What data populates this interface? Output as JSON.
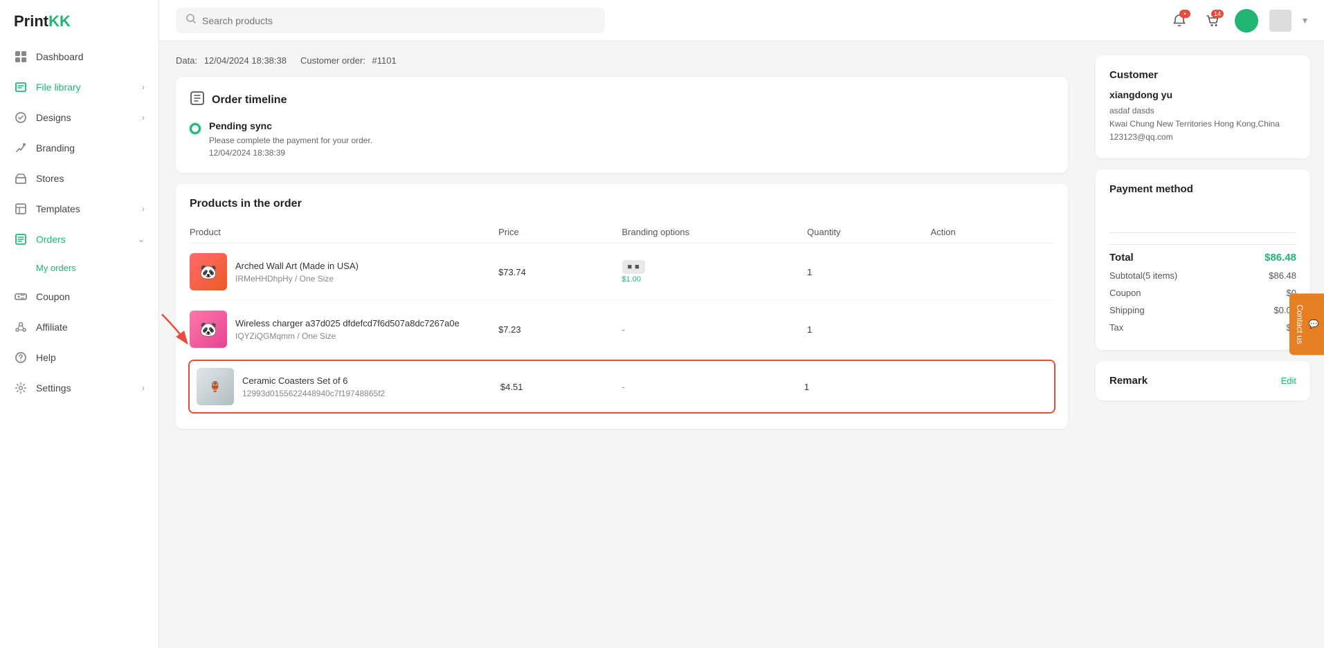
{
  "app": {
    "name": "PrintKK",
    "logo_colored": "KK"
  },
  "topbar": {
    "search_placeholder": "Search products",
    "cart_badge": "14",
    "chevron": "▾"
  },
  "sidebar": {
    "items": [
      {
        "id": "dashboard",
        "label": "Dashboard",
        "icon": "dashboard-icon",
        "has_children": false,
        "active": false
      },
      {
        "id": "file-library",
        "label": "File library",
        "icon": "file-library-icon",
        "has_children": true,
        "active": false
      },
      {
        "id": "designs",
        "label": "Designs",
        "icon": "designs-icon",
        "has_children": true,
        "active": false
      },
      {
        "id": "branding",
        "label": "Branding",
        "icon": "branding-icon",
        "has_children": false,
        "active": false
      },
      {
        "id": "stores",
        "label": "Stores",
        "icon": "stores-icon",
        "has_children": false,
        "active": false
      },
      {
        "id": "templates",
        "label": "Templates",
        "icon": "templates-icon",
        "has_children": true,
        "active": false
      },
      {
        "id": "orders",
        "label": "Orders",
        "icon": "orders-icon",
        "has_children": true,
        "active": true
      },
      {
        "id": "my-orders",
        "label": "My orders",
        "icon": "",
        "has_children": false,
        "active": true,
        "sub": true
      },
      {
        "id": "coupon",
        "label": "Coupon",
        "icon": "coupon-icon",
        "has_children": false,
        "active": false
      },
      {
        "id": "affiliate",
        "label": "Affiliate",
        "icon": "affiliate-icon",
        "has_children": false,
        "active": false
      },
      {
        "id": "help",
        "label": "Help",
        "icon": "help-icon",
        "has_children": false,
        "active": false
      },
      {
        "id": "settings",
        "label": "Settings",
        "icon": "settings-icon",
        "has_children": true,
        "active": false
      }
    ]
  },
  "order": {
    "date_label": "Data:",
    "date_value": "12/04/2024 18:38:38",
    "customer_order_label": "Customer order:",
    "customer_order_value": "#1101"
  },
  "timeline": {
    "title": "Order timeline",
    "status": "Pending sync",
    "description": "Please complete the payment for your order.",
    "timestamp": "12/04/2024 18:38:39"
  },
  "products": {
    "section_title": "Products in the order",
    "columns": {
      "product": "Product",
      "price": "Price",
      "branding_options": "Branding options",
      "quantity": "Quantity",
      "action": "Action"
    },
    "items": [
      {
        "id": "prod-1",
        "name": "Arched Wall Art (Made in USA)",
        "variant": "IRMeHHDhpHy / One Size",
        "price": "$73.74",
        "branding_label": "■ ■",
        "branding_price": "$1.00",
        "quantity": "1",
        "thumb_style": "pink",
        "highlighted": false
      },
      {
        "id": "prod-2",
        "name": "Wireless charger a37d025 dfdefcd7f6d507a8dc7267a0e",
        "variant": "IQYZiQGMqmm / One Size",
        "price": "$7.23",
        "branding_label": "-",
        "branding_price": "",
        "quantity": "1",
        "thumb_style": "pink2",
        "highlighted": false
      },
      {
        "id": "prod-3",
        "name": "Ceramic Coasters Set of 6",
        "variant": "12993d0155622448940c7f19748865f2",
        "price": "$4.51",
        "branding_label": "-",
        "branding_price": "",
        "quantity": "1",
        "thumb_style": "gray",
        "highlighted": true
      }
    ]
  },
  "customer": {
    "section_title": "Customer",
    "name": "xiangdong yu",
    "address_line1": "asdaf  dasds",
    "address_line2": "Kwai Chung  New Territories  Hong Kong,China",
    "email": "123123@qq.com"
  },
  "payment_method": {
    "section_title": "Payment method"
  },
  "summary": {
    "total_label": "Total",
    "total_value": "$86.48",
    "subtotal_label": "Subtotal(5 items)",
    "subtotal_value": "$86.48",
    "coupon_label": "Coupon",
    "coupon_value": "$0",
    "shipping_label": "Shipping",
    "shipping_value": "$0.00",
    "tax_label": "Tax",
    "tax_value": "$0"
  },
  "remark": {
    "title": "Remark",
    "edit_label": "Edit"
  },
  "contact": {
    "label": "Contact us"
  }
}
